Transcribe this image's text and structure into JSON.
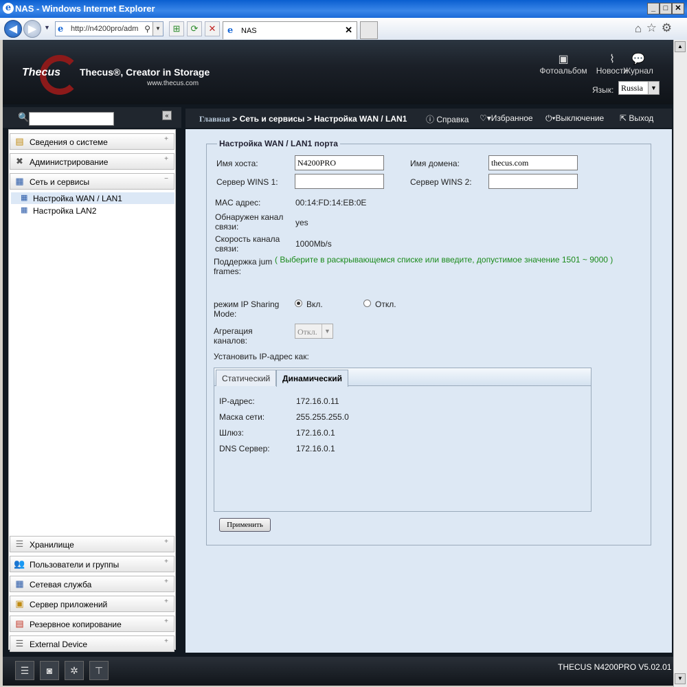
{
  "window": {
    "title": "NAS - Windows Internet Explorer"
  },
  "browser": {
    "address": "http://n4200pro/adm",
    "tab_title": "NAS"
  },
  "header": {
    "logo": "Thecus",
    "slogan": "Thecus®, Creator in Storage",
    "url": "www.thecus.com",
    "links": {
      "photo": "Фотоальбом",
      "news": "Новости",
      "journal": "Журнал"
    },
    "language_label": "Язык:",
    "language_value": "Russia"
  },
  "sidebar": {
    "sections_top": [
      {
        "label": "Сведения о системе",
        "icon": "document-icon"
      },
      {
        "label": "Администрирование",
        "icon": "tools-icon"
      },
      {
        "label": "Сеть и сервисы",
        "icon": "network-icon"
      }
    ],
    "subitems": [
      {
        "label": "Настройка WAN / LAN1"
      },
      {
        "label": "Настройка LAN2"
      }
    ],
    "sections_bottom": [
      {
        "label": "Хранилище",
        "icon": "storage-icon"
      },
      {
        "label": "Пользователи и группы",
        "icon": "users-icon"
      },
      {
        "label": "Сетевая служба",
        "icon": "network-service-icon"
      },
      {
        "label": "Сервер приложений",
        "icon": "app-server-icon"
      },
      {
        "label": "Резервное копирование",
        "icon": "backup-icon"
      },
      {
        "label": "External Device",
        "icon": "external-device-icon"
      }
    ]
  },
  "main_header": {
    "breadcrumb_home": "Главная",
    "breadcrumb_rest": " > Сеть и сервисы > Настройка WAN / LAN1",
    "help": "Справка",
    "favorites": "Избранное",
    "shutdown": "Выключение",
    "logout": "Выход"
  },
  "form": {
    "legend": "Настройка WAN / LAN1 порта",
    "hostname_label": "Имя хоста:",
    "hostname_value": "N4200PRO",
    "domain_label": "Имя домена:",
    "domain_value": "thecus.com",
    "wins1_label": "Сервер WINS 1:",
    "wins1_value": "",
    "wins2_label": "Сервер WINS 2:",
    "wins2_value": "",
    "mac_label": "MAC адрес:",
    "mac_value": "00:14:FD:14:EB:0E",
    "link_label_1": "Обнаружен канал",
    "link_label_2": "связи:",
    "link_value": "yes",
    "speed_label_1": "Скорость канала",
    "speed_label_2": "связи:",
    "speed_value": "1000Mb/s",
    "jumbo_label_1": "Поддержка jum",
    "jumbo_label_2": "frames:",
    "jumbo_hint": "( Выберите в раскрывающемся списке или введите, допустимое значение 1501 ~ 9000 )",
    "ipshare_label_1": "режим IP Sharing",
    "ipshare_label_2": "Mode:",
    "ipshare_on": "Вкл.",
    "ipshare_off": "Откл.",
    "agg_label_1": "Агрегация",
    "agg_label_2": "каналов:",
    "agg_value": "Откл.",
    "set_ip_label": "Установить IP-адрес как:",
    "tabs": {
      "static": "Статический",
      "dynamic": "Динамический"
    },
    "ip_label": "IP-адрес:",
    "ip_value": "172.16.0.11",
    "mask_label": "Маска сети:",
    "mask_value": "255.255.255.0",
    "gateway_label": "Шлюз:",
    "gateway_value": "172.16.0.1",
    "dns_label": "DNS Сервер:",
    "dns_value": "172.16.0.1",
    "apply": "Применить"
  },
  "footer": {
    "version": "THECUS N4200PRO V5.02.01"
  }
}
